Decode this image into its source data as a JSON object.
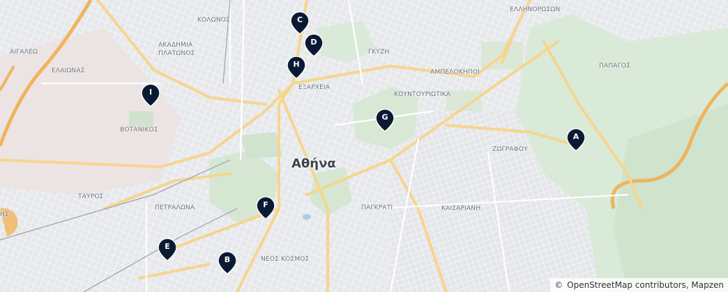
{
  "map": {
    "city_label": "Αθήνα",
    "districts": {
      "kolonos": "ΚΟΛΩΝΟΣ",
      "ellinoroson": "ΕΛΛΗΝΟΡΩΣΩΝ",
      "akadimia": "ΑΚΑΔΗΜΙΑ",
      "platonos": "ΠΛΑΤΩΝΟΣ",
      "aigaleo": "ΑΙΓΑΛΕΩ",
      "elaionas": "ΕΛΑΙΩΝΑΣ",
      "gkyzi": "ΓΚΥΖΗ",
      "papagos": "ΠΑΠΑΓΟΣ",
      "ampelokipoi": "ΑΜΠΕΛΟΚΗΠΟΙ",
      "exarcheia": "ΕΞΑΡΧΕΙΑ",
      "kountouriotika": "ΚΟΥΝΤΟΥΡΙΩΤΙΚΑ",
      "votanikos": "ΒΟΤΑΝΙΚΟΣ",
      "zografou": "ΖΩΓΡΑΦΟΥ",
      "tavros": "ΤΑΥΡΟΣ",
      "petralona": "ΠΕΤΡΑΛΩΝΑ",
      "pagkrati": "ΠΑΓΚΡΑΤΙ",
      "kaisariani": "ΚΑΙΣΑΡΙΑΝΗ",
      "neos_kosmos": "ΝΕΟΣ ΚΟΣΜΟΣ",
      "rentis_fragment": "ΗΣ"
    },
    "markers": [
      {
        "letter": "A"
      },
      {
        "letter": "B"
      },
      {
        "letter": "C"
      },
      {
        "letter": "D"
      },
      {
        "letter": "E"
      },
      {
        "letter": "F"
      },
      {
        "letter": "G"
      },
      {
        "letter": "H"
      },
      {
        "letter": "I"
      }
    ],
    "marker_color": "#0b1a33",
    "attribution": {
      "symbol": "©",
      "text": "OpenStreetMap contributors, Mapzen"
    }
  }
}
